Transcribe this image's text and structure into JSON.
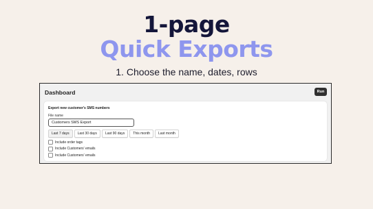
{
  "hero": {
    "title": "1-page",
    "subtitle": "Quick Exports",
    "step": "1. Choose the name, dates, rows"
  },
  "window": {
    "header": "Dashboard",
    "run_label": "Run"
  },
  "card": {
    "title": "Export new customer's SMS numbers",
    "file_name_label": "File name",
    "file_name_value": "Customers SMS Export",
    "date_ranges": [
      "Last 7 days",
      "Last 30 days",
      "Last 90 days",
      "This month",
      "Last month"
    ],
    "selected_range": "Last 7 days",
    "options": [
      {
        "label": "Include order tags",
        "checked": false
      },
      {
        "label": "Include Customers' emails",
        "checked": false
      },
      {
        "label": "Include Customers' emails",
        "checked": false
      }
    ]
  },
  "colors": {
    "background": "#f6f0ea",
    "title": "#14163a",
    "accent": "#8e96ee",
    "run_button": "#303030"
  }
}
